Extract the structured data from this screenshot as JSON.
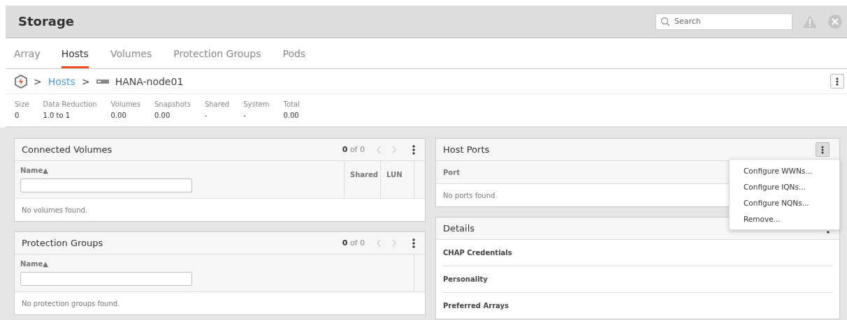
{
  "header": {
    "title": "Storage",
    "search": {
      "placeholder": "Search"
    }
  },
  "tabs": [
    {
      "label": "Array",
      "selected": false
    },
    {
      "label": "Hosts",
      "selected": true
    },
    {
      "label": "Volumes",
      "selected": false
    },
    {
      "label": "Protection Groups",
      "selected": false
    },
    {
      "label": "Pods",
      "selected": false
    }
  ],
  "breadcrumb": {
    "separator": ">",
    "link": "Hosts",
    "current": "HANA-node01"
  },
  "stats": [
    {
      "label": "Size",
      "value": "0"
    },
    {
      "label": "Data Reduction",
      "value": "1.0 to 1"
    },
    {
      "label": "Volumes",
      "value": "0.00"
    },
    {
      "label": "Snapshots",
      "value": "0.00"
    },
    {
      "label": "Shared",
      "value": "-"
    },
    {
      "label": "System",
      "value": "-"
    },
    {
      "label": "Total",
      "value": "0.00"
    }
  ],
  "left_panels": [
    {
      "title": "Connected Volumes",
      "pager": "**0** of 0",
      "columns": [
        "Name▲",
        "Shared",
        "LUN"
      ],
      "empty": "No volumes found."
    },
    {
      "title": "Protection Groups",
      "pager": "**0** of 0",
      "columns": [
        "Name▲"
      ],
      "empty": "No protection groups found."
    }
  ],
  "host_ports": {
    "title": "Host Ports",
    "columns": [
      "Port"
    ],
    "empty": "No ports found."
  },
  "details": {
    "title": "Details",
    "rows": [
      "CHAP Credentials",
      "Personality",
      "Preferred Arrays"
    ]
  },
  "menu": {
    "items": [
      "Configure WWNs...",
      "Configure IQNs...",
      "Configure NQNs...",
      "Remove..."
    ]
  }
}
